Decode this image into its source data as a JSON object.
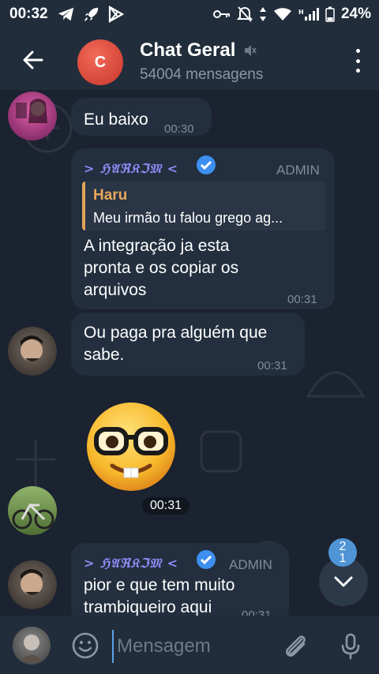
{
  "statusbar": {
    "time": "00:32",
    "battery": "24%"
  },
  "header": {
    "avatar_letter": "C",
    "title": "Chat Geral",
    "subtitle": "54004 mensagens"
  },
  "messages": [
    {
      "text": "Eu baixo",
      "time": "00:30"
    },
    {
      "sender": "> ℌ𝔄ℜ𝔎ℑ𝔐 <",
      "role": "ADMIN",
      "reply": {
        "name": "Haru",
        "text": "Meu irmão tu falou grego ag..."
      },
      "lines": [
        "A integração ja esta",
        "pronta e os copiar os",
        "arquivos"
      ],
      "time": "00:31"
    },
    {
      "lines": [
        "Ou paga pra alguém que",
        "sabe."
      ],
      "time": "00:31"
    },
    {
      "sticker": "nerd-face",
      "time": "00:31"
    },
    {
      "sender": "> ℌ𝔄ℜ𝔎ℑ𝔐 <",
      "role": "ADMIN",
      "lines": [
        "pior e que tem muito",
        "trambiqueiro aqui"
      ],
      "time": "00:31"
    }
  ],
  "scroll": {
    "badge_top": "2",
    "badge_bottom": "1"
  },
  "input": {
    "placeholder": "Mensagem"
  },
  "colors": {
    "accent": "#5aa2e8",
    "admin_name": "#8e8cf7",
    "reply_name": "#e6a85c",
    "badge": "#4f95d6"
  }
}
